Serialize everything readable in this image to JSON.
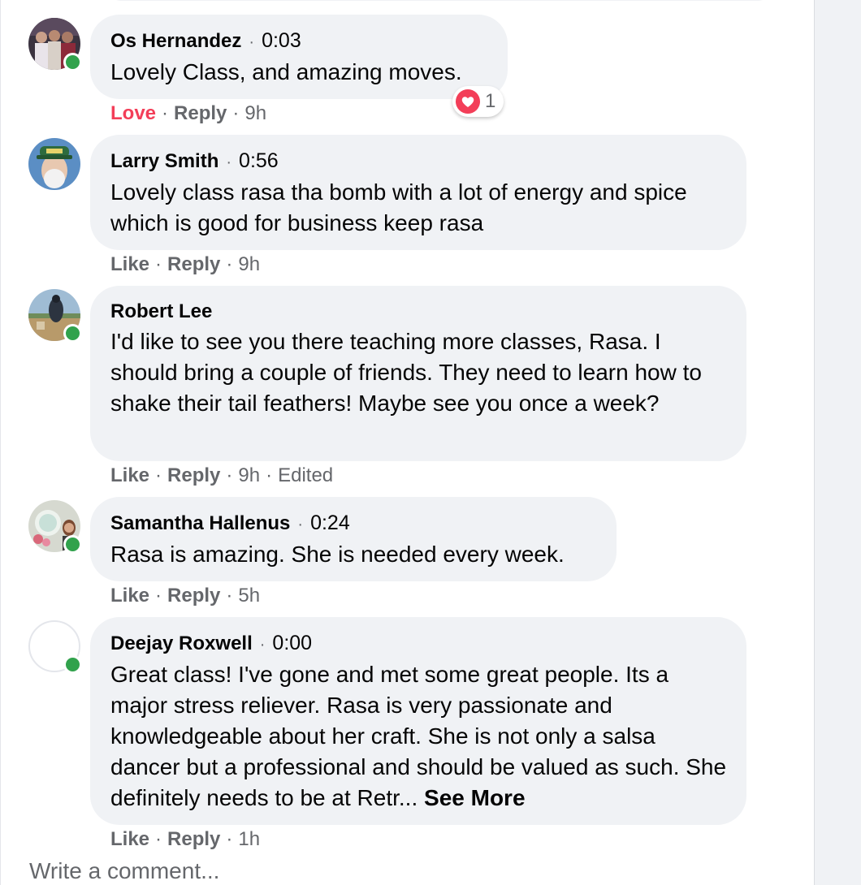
{
  "comments": [
    {
      "author": "Os Hernandez",
      "timestamp": "0:03",
      "text": "Lovely Class, and amazing moves.",
      "reaction_label": "Love",
      "reply_label": "Reply",
      "age": "9h",
      "reaction_count": "1",
      "online": true
    },
    {
      "author": "Larry Smith",
      "timestamp": "0:56",
      "text": "Lovely class rasa tha bomb with a lot of energy and spice which is good for business keep rasa",
      "reaction_label": "Like",
      "reply_label": "Reply",
      "age": "9h",
      "online": false
    },
    {
      "author": "Robert Lee",
      "text": "I'd like to see you there teaching more classes, Rasa. I should bring a couple of friends. They need to learn how to shake their tail feathers! Maybe see you once a week?",
      "reaction_label": "Like",
      "reply_label": "Reply",
      "age": "9h",
      "edited": "Edited",
      "online": true
    },
    {
      "author": "Samantha Hallenus",
      "timestamp": "0:24",
      "text": "Rasa is amazing. She is needed every week.",
      "reaction_label": "Like",
      "reply_label": "Reply",
      "age": "5h",
      "online": true
    },
    {
      "author": "Deejay Roxwell",
      "timestamp": "0:00",
      "text": "Great class! I've gone and met some great people. Its a major stress reliever. Rasa is very passionate and knowledgeable about her craft. She is not only a salsa dancer but a professional and should be valued as such. She definitely needs to be at Retr...",
      "see_more": "See More",
      "reaction_label": "Like",
      "reply_label": "Reply",
      "age": "1h",
      "online": true
    }
  ],
  "composer": {
    "placeholder": "Write a comment..."
  },
  "colors": {
    "bubble": "#f0f2f5",
    "secondary_text": "#65676b",
    "love": "#f33e58",
    "online": "#31a24c"
  }
}
